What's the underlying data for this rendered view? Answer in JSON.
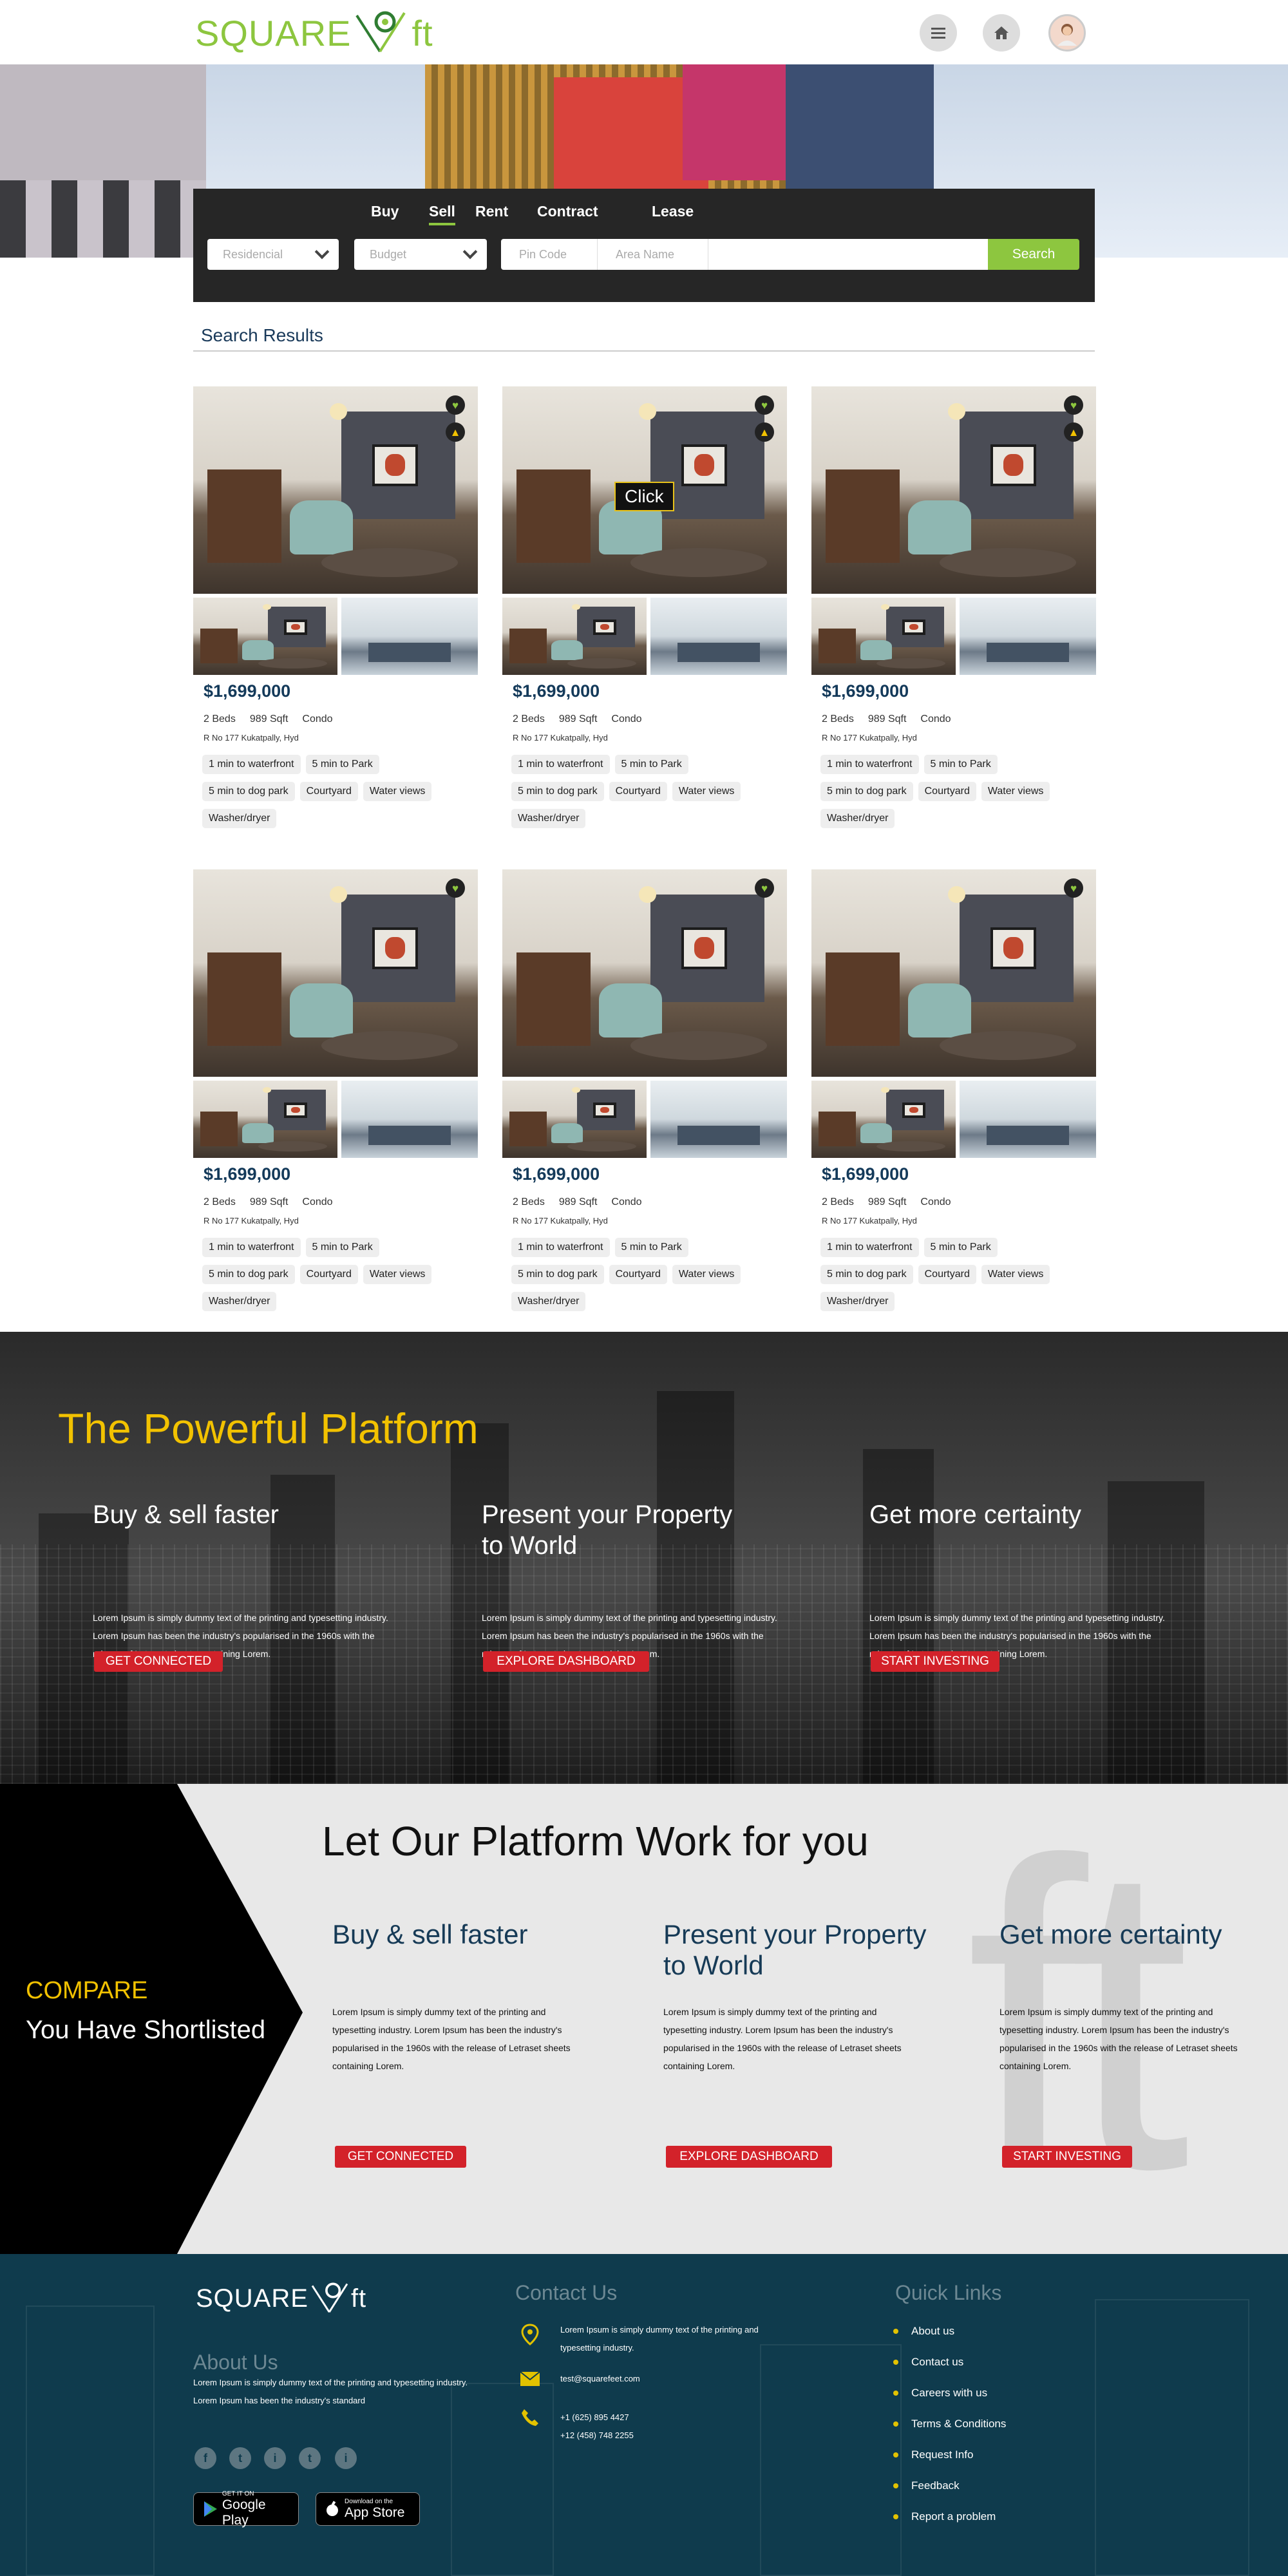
{
  "header": {
    "logo_left": "SQUARE",
    "logo_right": "ft",
    "menu_icon": "menu-icon",
    "home_icon": "home-icon",
    "avatar_icon": "user-avatar"
  },
  "search": {
    "tabs": [
      "Buy",
      "Sell",
      "Rent",
      "Contract",
      "Lease"
    ],
    "active_tab": "Sell",
    "type_value": "Residencial",
    "budget_value": "Budget",
    "pincode_placeholder": "Pin Code",
    "area_placeholder": "Area Name",
    "search_button": "Search"
  },
  "results": {
    "title": "Search Results",
    "click_tooltip": "Click",
    "listings": [
      {
        "price": "$1,699,000",
        "beds": "2 Beds",
        "sqft": "989 Sqft",
        "type": "Condo",
        "address": "R No 177 Kukatpally, Hyd",
        "features": [
          "1 min to waterfront",
          "5 min to Park",
          "5 min to dog park",
          "Courtyard",
          "Water views",
          "Washer/dryer"
        ],
        "hot": true
      },
      {
        "price": "$1,699,000",
        "beds": "2 Beds",
        "sqft": "989 Sqft",
        "type": "Condo",
        "address": "R No 177 Kukatpally, Hyd",
        "features": [
          "1 min to waterfront",
          "5 min to Park",
          "5 min to dog park",
          "Courtyard",
          "Water views",
          "Washer/dryer"
        ],
        "hot": true
      },
      {
        "price": "$1,699,000",
        "beds": "2 Beds",
        "sqft": "989 Sqft",
        "type": "Condo",
        "address": "R No 177 Kukatpally, Hyd",
        "features": [
          "1 min to waterfront",
          "5 min to Park",
          "5 min to dog park",
          "Courtyard",
          "Water views",
          "Washer/dryer"
        ],
        "hot": true
      },
      {
        "price": "$1,699,000",
        "beds": "2 Beds",
        "sqft": "989 Sqft",
        "type": "Condo",
        "address": "R No 177 Kukatpally, Hyd",
        "features": [
          "1 min to waterfront",
          "5 min to Park",
          "5 min to dog park",
          "Courtyard",
          "Water views",
          "Washer/dryer"
        ],
        "hot": false
      },
      {
        "price": "$1,699,000",
        "beds": "2 Beds",
        "sqft": "989 Sqft",
        "type": "Condo",
        "address": "R No 177 Kukatpally, Hyd",
        "features": [
          "1 min to waterfront",
          "5 min to Park",
          "5 min to dog park",
          "Courtyard",
          "Water views",
          "Washer/dryer"
        ],
        "hot": false
      },
      {
        "price": "$1,699,000",
        "beds": "2 Beds",
        "sqft": "989 Sqft",
        "type": "Condo",
        "address": "R No 177 Kukatpally, Hyd",
        "features": [
          "1 min to waterfront",
          "5 min to Park",
          "5 min to dog park",
          "Courtyard",
          "Water views",
          "Washer/dryer"
        ],
        "hot": false
      }
    ]
  },
  "platform": {
    "title": "The Powerful Platform",
    "columns": [
      {
        "heading": "Buy & sell faster",
        "text": "Lorem Ipsum is simply dummy text of the printing and typesetting industry. Lorem Ipsum has been the industry's popularised in the 1960s with the release of Letraset sheets containing Lorem.",
        "button": "GET CONNECTED"
      },
      {
        "heading": "Present your Property to World",
        "text": "Lorem Ipsum is simply dummy text of the printing and typesetting industry. Lorem Ipsum has been the industry's popularised in the 1960s with the release of Letraset sheets containing Lorem.",
        "button": "EXPLORE DASHBOARD"
      },
      {
        "heading": "Get more certainty",
        "text": "Lorem Ipsum is simply dummy text of the printing and typesetting industry. Lorem Ipsum has been the industry's popularised in the 1960s with the release of Letraset sheets containing Lorem.",
        "button": "START INVESTING"
      }
    ]
  },
  "work": {
    "title": "Let Our Platform Work for you",
    "compare_label": "COMPARE",
    "shortlist_label": "You Have Shortlisted",
    "watermark": "ft",
    "columns": [
      {
        "heading": "Buy & sell faster",
        "text": "Lorem Ipsum is simply dummy text of the printing and typesetting industry. Lorem Ipsum has been the industry's popularised in the 1960s with the release of Letraset sheets containing Lorem.",
        "button": "GET CONNECTED"
      },
      {
        "heading": "Present your Property to World",
        "text": "Lorem Ipsum is simply dummy text of the printing and typesetting industry. Lorem Ipsum has been the industry's popularised in the 1960s with the release of Letraset sheets containing Lorem.",
        "button": "EXPLORE DASHBOARD"
      },
      {
        "heading": "Get more certainty",
        "text": "Lorem Ipsum is simply dummy text of the printing and typesetting industry. Lorem Ipsum has been the industry's popularised in the 1960s with the release of Letraset sheets containing Lorem.",
        "button": "START INVESTING"
      }
    ]
  },
  "footer": {
    "logo_left": "SQUARE",
    "logo_right": "ft",
    "about_title": "About Us",
    "about_text": "Lorem Ipsum is simply dummy text of the printing and typesetting industry. Lorem Ipsum has been the industry's standard",
    "social": [
      "f",
      "t",
      "i",
      "t",
      "i"
    ],
    "google_small": "GET IT ON",
    "google_large": "Google Play",
    "apple_small": "Download on the",
    "apple_large": "App Store",
    "contact_title": "Contact Us",
    "contact_address": "Lorem Ipsum is simply dummy text of the printing and typesetting industry.",
    "contact_email": "test@squarefeet.com",
    "contact_phone1": "+1 (625) 895 4427",
    "contact_phone2": "+12 (458) 748 2255",
    "quick_title": "Quick Links",
    "quick_links": [
      "About us",
      "Contact us",
      "Careers with us",
      "Terms & Conditions",
      "Request Info",
      "Feedback",
      "Report a problem"
    ]
  },
  "colors": {
    "brand_green": "#8dc63f",
    "accent_yellow": "#f2c200",
    "button_red": "#d3222a",
    "footer_navy": "#0f3b4d"
  }
}
